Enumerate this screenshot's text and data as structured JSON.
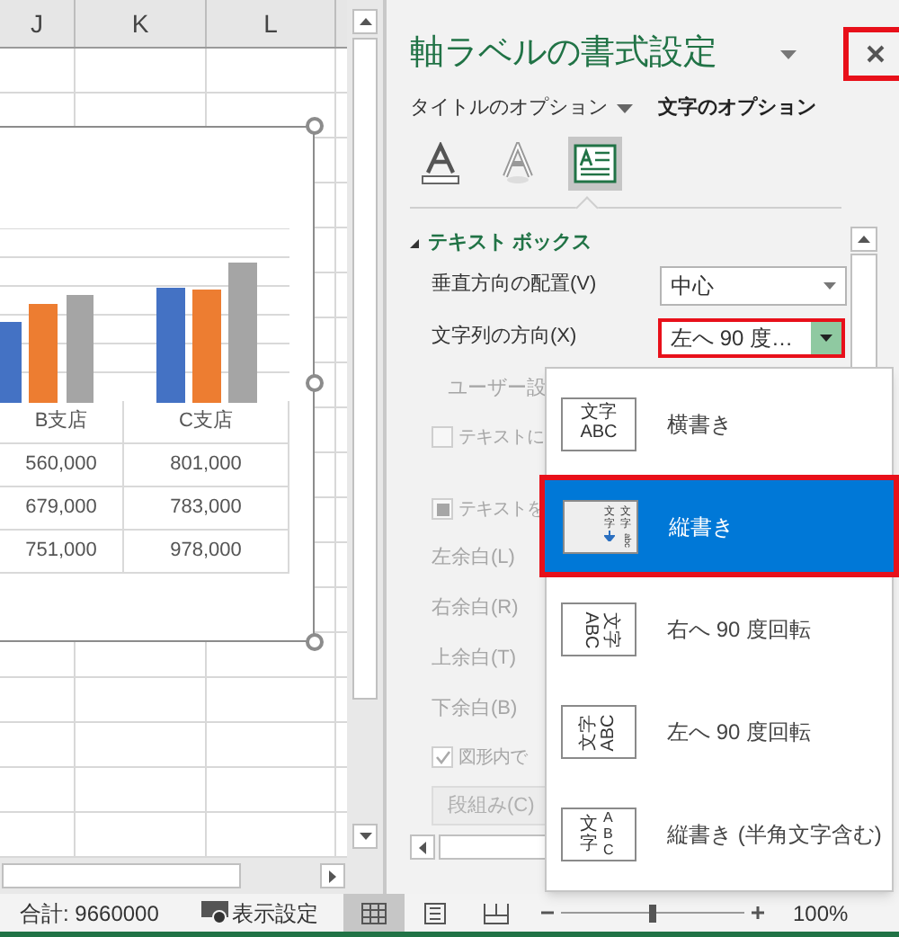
{
  "sheet": {
    "columns": [
      "J",
      "K",
      "L"
    ],
    "chart_table": {
      "headers": [
        "B支店",
        "C支店"
      ],
      "rows": [
        [
          "560,000",
          "801,000"
        ],
        [
          "679,000",
          "783,000"
        ],
        [
          "751,000",
          "978,000"
        ]
      ]
    }
  },
  "pane": {
    "title": "軸ラベルの書式設定",
    "close_highlighted": true,
    "tabs": [
      {
        "label": "タイトルのオプション",
        "selected": false,
        "has_menu": true
      },
      {
        "label": "文字のオプション",
        "selected": true,
        "has_menu": false
      }
    ],
    "icon_tabs": [
      {
        "kind": "fill",
        "selected": false
      },
      {
        "kind": "effects",
        "selected": false
      },
      {
        "kind": "textbox",
        "selected": true
      }
    ],
    "section": {
      "title": "テキスト ボックス",
      "expanded": true
    },
    "rows": [
      {
        "kind": "select",
        "label": "垂直方向の配置(V)",
        "value": "中心",
        "highlighted": false,
        "open": false
      },
      {
        "kind": "select",
        "label": "文字列の方向(X)",
        "value": "左へ 90 度…",
        "highlighted": true,
        "open": true
      },
      {
        "kind": "label",
        "label": "ユーザー設",
        "disabled": true
      },
      {
        "kind": "checkbox",
        "label": "テキストに",
        "checked": false,
        "mixed": false,
        "disabled": true
      },
      {
        "kind": "gap"
      },
      {
        "kind": "checkbox",
        "label": "テキストを",
        "checked": false,
        "mixed": true,
        "disabled": true
      },
      {
        "kind": "label",
        "label": "左余白(L)",
        "disabled": true
      },
      {
        "kind": "label",
        "label": "右余白(R)",
        "disabled": true
      },
      {
        "kind": "label",
        "label": "上余白(T)",
        "disabled": true
      },
      {
        "kind": "label",
        "label": "下余白(B)",
        "disabled": true
      },
      {
        "kind": "checkbox",
        "label": "図形内で",
        "checked": true,
        "mixed": false,
        "disabled": true
      },
      {
        "kind": "button",
        "label": "段組み(C)",
        "disabled": true
      }
    ]
  },
  "dropdown": {
    "items": [
      {
        "kind": "horizontal",
        "label": "横書き",
        "sample": [
          "文字",
          "ABC"
        ],
        "selected": false,
        "highlighted": false
      },
      {
        "kind": "vertical",
        "label": "縦書き",
        "sample": [
          "文字",
          "文字",
          "abc"
        ],
        "selected": true,
        "highlighted": true
      },
      {
        "kind": "rotate_right",
        "label": "右へ 90 度回転",
        "sample": [
          "文字",
          "ABC"
        ],
        "selected": false,
        "highlighted": false
      },
      {
        "kind": "rotate_left",
        "label": "左へ 90 度回転",
        "sample": [
          "文字",
          "ABC"
        ],
        "selected": false,
        "highlighted": false
      },
      {
        "kind": "stacked",
        "label": "縦書き (半角文字含む)",
        "sample": [
          "文字",
          "ABC"
        ],
        "selected": false,
        "highlighted": false
      }
    ]
  },
  "status_bar": {
    "sum": "合計: 9660000",
    "display_settings": "表示設定",
    "zoom": "100%",
    "views": [
      {
        "kind": "normal",
        "selected": true
      },
      {
        "kind": "page_layout",
        "selected": false
      },
      {
        "kind": "page_break",
        "selected": false
      }
    ],
    "zoom_slider": {
      "level": 0.5
    }
  }
}
